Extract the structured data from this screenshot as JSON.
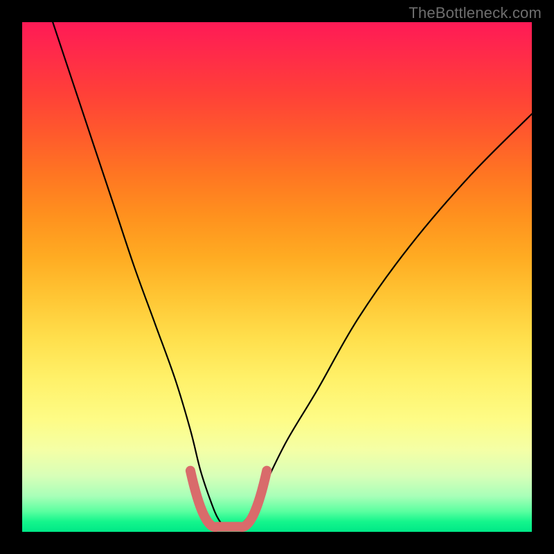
{
  "watermark": {
    "text": "TheBottleneck.com"
  },
  "colors": {
    "curve": "#000000",
    "valley_marker": "#d96b6b",
    "gradient_stops": [
      "#ff1a56",
      "#ff2a4a",
      "#ff4038",
      "#ff5a2c",
      "#ff7622",
      "#ff911e",
      "#ffab22",
      "#ffc634",
      "#ffdf4c",
      "#fff169",
      "#fefc86",
      "#f4ffa6",
      "#d8ffb8",
      "#a8ffb8",
      "#5affa0",
      "#14f58c",
      "#00e887"
    ]
  },
  "chart_data": {
    "type": "line",
    "title": "",
    "xlabel": "",
    "ylabel": "",
    "xlim": [
      0,
      100
    ],
    "ylim": [
      0,
      100
    ],
    "grid": false,
    "legend": false,
    "series": [
      {
        "name": "bottleneck-curve",
        "x": [
          6,
          10,
          14,
          18,
          22,
          26,
          30,
          33,
          35,
          37,
          38.5,
          40,
          42,
          44,
          46,
          48,
          52,
          58,
          66,
          76,
          88,
          100
        ],
        "y": [
          100,
          88,
          76,
          64,
          52,
          41,
          30,
          20,
          12,
          6,
          2.5,
          1,
          1,
          2.5,
          6,
          10,
          18,
          28,
          42,
          56,
          70,
          82
        ]
      }
    ],
    "annotations": [
      {
        "name": "valley-marker",
        "shape": "u",
        "x_range": [
          33,
          48
        ],
        "y_base": 1,
        "y_top": 12
      }
    ]
  }
}
